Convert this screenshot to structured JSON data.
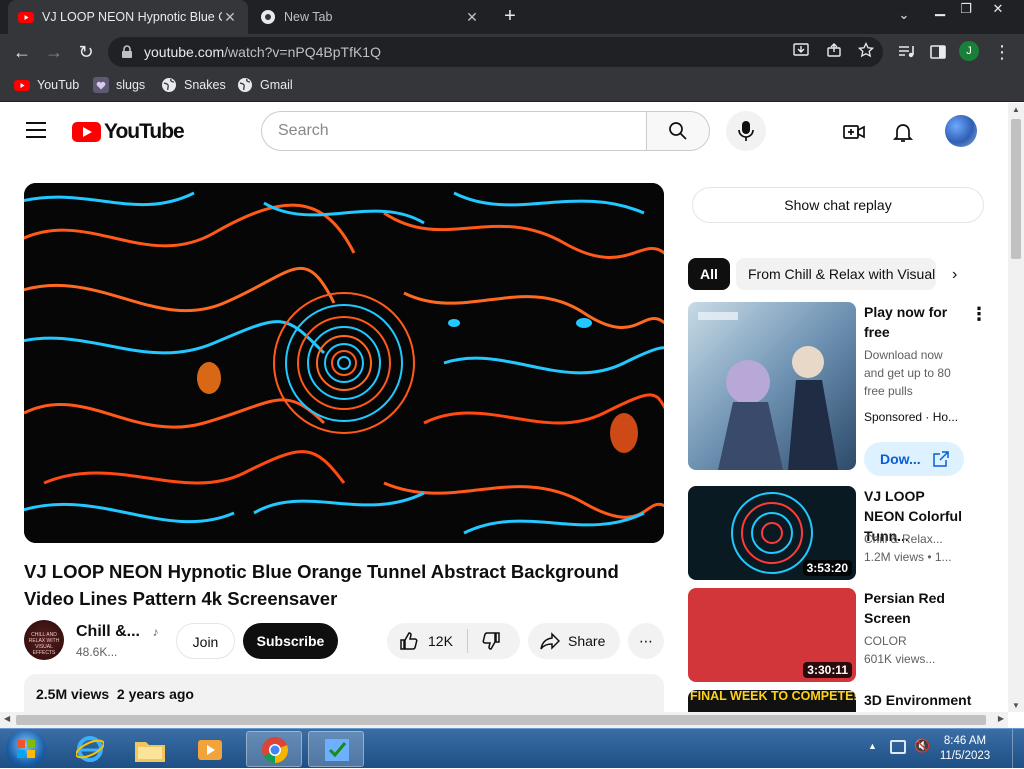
{
  "browser": {
    "tabs": [
      {
        "label": "VJ LOOP NEON Hypnotic Blue Or",
        "active": true
      },
      {
        "label": "New Tab",
        "active": false
      }
    ],
    "url_host": "youtube.com",
    "url_path": "/watch?v=nPQ4BpTfK1Q",
    "profile_initial": "J",
    "bookmarks": [
      {
        "label": "YouTub",
        "icon": "youtube-icon"
      },
      {
        "label": "slugs",
        "icon": "heart-icon"
      },
      {
        "label": "Snakes",
        "icon": "globe-icon"
      },
      {
        "label": "Gmail",
        "icon": "globe-icon"
      }
    ]
  },
  "youtube": {
    "logo_text": "YouTube",
    "search_placeholder": "Search",
    "video_title": "VJ LOOP NEON Hypnotic Blue Orange Tunnel Abstract Background Video Lines Pattern 4k Screensaver",
    "channel_name": "Chill &...",
    "channel_subs": "48.6K...",
    "channel_avatar_text": "CHILL AND RELAX WITH VISUAL EFFECTS",
    "join_label": "Join",
    "subscribe_label": "Subscribe",
    "likes": "12K",
    "share_label": "Share",
    "views_line": "2.5M views  2 years ago",
    "chat_replay_label": "Show chat replay",
    "chips": [
      "All",
      "From Chill & Relax with Visual"
    ],
    "recommendations": [
      {
        "title": "Play now for free",
        "meta1": "Download now and get up to 80 free pulls",
        "meta2": "Sponsored · Ho...",
        "cta": "Dow...",
        "duration": ""
      },
      {
        "title": "VJ LOOP NEON Colorful Tunn...",
        "meta1": "Chill & Relax...",
        "meta2": "1.2M views  • 1...",
        "duration": "3:53:20"
      },
      {
        "title": "Persian Red Screen",
        "meta1": "COLOR",
        "meta2": "601K views...",
        "duration": "3:30:11"
      },
      {
        "title": "3D Environment",
        "meta1": "",
        "meta2": "",
        "duration": "",
        "thumb_text": "FINAL WEEK TO COMPETE!"
      }
    ]
  },
  "taskbar": {
    "time": "8:46 AM",
    "date": "11/5/2023"
  },
  "colors": {
    "youtube_red": "#ff0000",
    "chrome_dark": "#202124",
    "chrome_toolbar": "#35363a",
    "neon_orange": "#ff5a1a",
    "neon_blue": "#22c8ff"
  }
}
